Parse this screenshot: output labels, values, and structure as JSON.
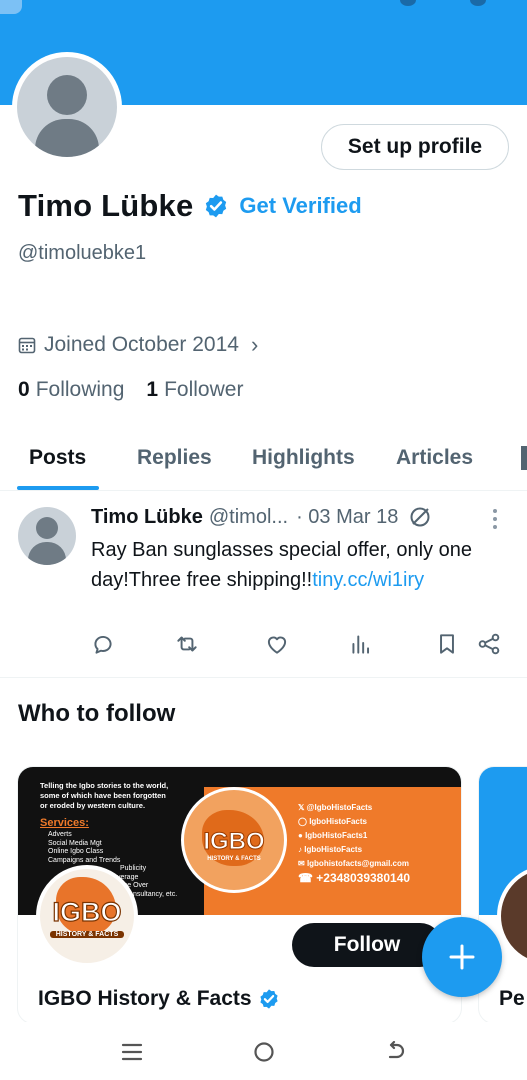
{
  "colors": {
    "accent": "#1d9bf0",
    "text": "#0f1419",
    "muted": "#536471"
  },
  "profile": {
    "setup_button": "Set up profile",
    "name": "Timo Lübke",
    "get_verified": "Get Verified",
    "handle": "@timoluebke1",
    "joined": "Joined October 2014",
    "following_count": "0",
    "following_label": "Following",
    "followers_count": "1",
    "followers_label": "Follower"
  },
  "tabs": [
    {
      "label": "Posts",
      "active": true
    },
    {
      "label": "Replies"
    },
    {
      "label": "Highlights"
    },
    {
      "label": "Articles"
    }
  ],
  "post": {
    "name": "Timo Lübke",
    "handle": "@timol...",
    "date": "· 03 Mar 18",
    "text": "Ray Ban sunglasses special offer, only one day!Three free shipping!!",
    "link": "tiny.cc/wi1iry"
  },
  "who_to_follow": {
    "title": "Who to follow",
    "card": {
      "banner_line1": "Telling the Igbo stories to the world,",
      "banner_line2": "some of which have been forgotten",
      "banner_line3": "or eroded by western culture.",
      "services_title": "Services:",
      "services": [
        "Adverts",
        "Social Media Mgt",
        "Online Igbo Class",
        "Campaigns and Trends",
        "Publicity",
        "Coverage",
        "Voice Over",
        "Consultancy, etc."
      ],
      "logo_text": "IGBO",
      "logo_sub": "HISTORY & FACTS",
      "social_x": "@IgboHistoFacts",
      "social_ig": "IgboHistoFacts",
      "social_fb": "IgboHistoFacts1",
      "social_tt": "IgboHistoFacts",
      "social_mail": "Igbohistofacts@gmail.com",
      "social_phone": "+2348039380140",
      "follow_label": "Follow",
      "name": "IGBO History & Facts"
    },
    "card2_name": "Pe"
  }
}
